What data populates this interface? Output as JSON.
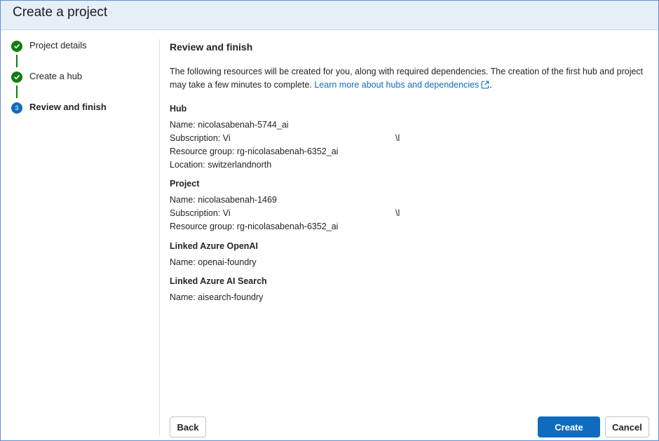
{
  "dialog": {
    "title": "Create a project"
  },
  "steps": [
    {
      "number": "1",
      "label": "Project details",
      "state": "done"
    },
    {
      "number": "2",
      "label": "Create a hub",
      "state": "done"
    },
    {
      "number": "3",
      "label": "Review and finish",
      "state": "current"
    }
  ],
  "review": {
    "heading": "Review and finish",
    "intro_text": "The following resources will be created for you, along with required dependencies. The creation of the first hub and project may take a few minutes to complete. ",
    "learn_more_link": "Learn more about hubs and dependencies",
    "intro_end": "."
  },
  "hub": {
    "title": "Hub",
    "name": "Name: nicolasabenah-5744_ai",
    "subscription_prefix": "Subscription: Vi",
    "subscription_suffix": "\\l",
    "resource_group": "Resource group: rg-nicolasabenah-6352_ai",
    "location": "Location: switzerlandnorth"
  },
  "project": {
    "title": "Project",
    "name": "Name: nicolasabenah-1469",
    "subscription_prefix": "Subscription: Vi",
    "subscription_suffix": "\\l",
    "resource_group": "Resource group: rg-nicolasabenah-6352_ai"
  },
  "openai": {
    "title": "Linked Azure OpenAI",
    "name": "Name: openai-foundry"
  },
  "search": {
    "title": "Linked Azure AI Search",
    "name": "Name: aisearch-foundry"
  },
  "buttons": {
    "back": "Back",
    "create": "Create",
    "cancel": "Cancel"
  },
  "colors": {
    "accent": "#0f6cbd",
    "success": "#107c10",
    "title_bar": "#e6eef8"
  },
  "icons": {
    "step_done": "checkmark-icon",
    "external_link": "external-link-icon"
  }
}
